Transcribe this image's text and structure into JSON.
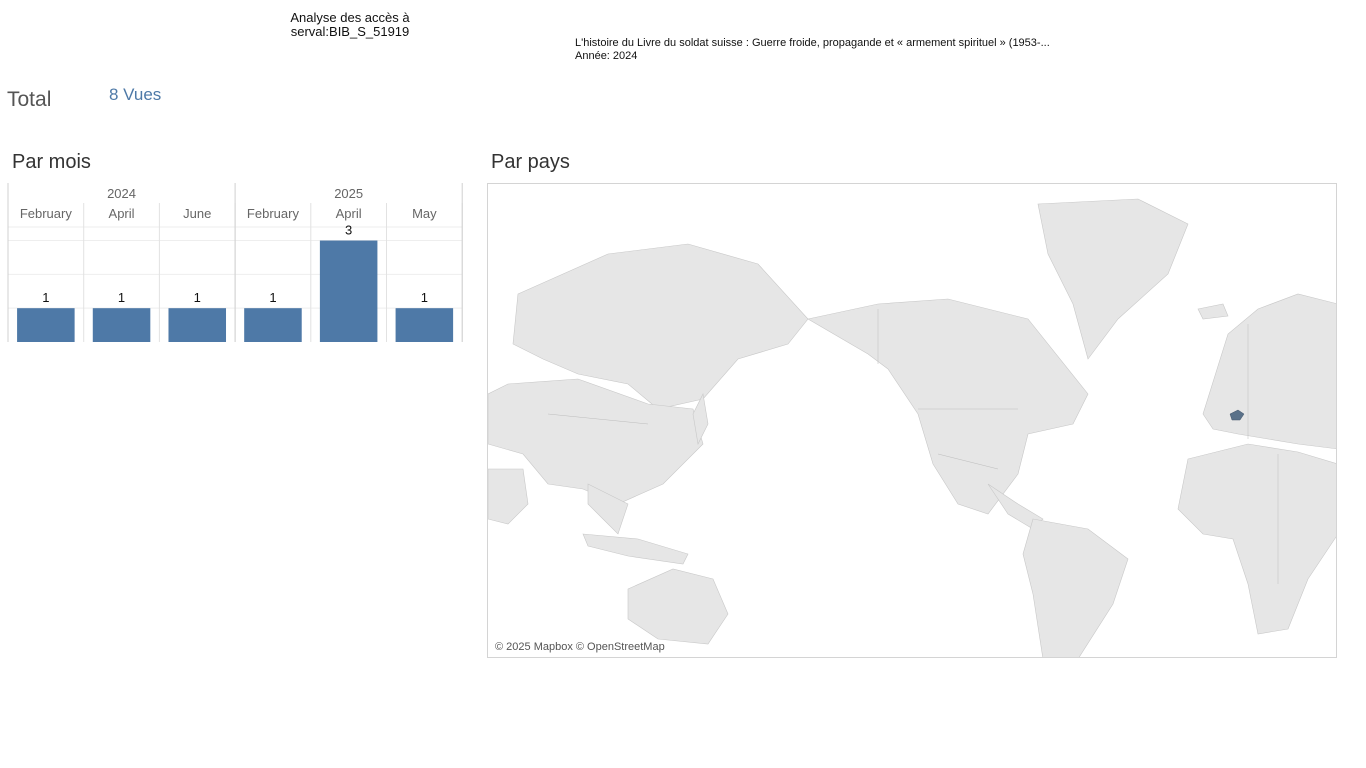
{
  "header": {
    "analysis_line1": "Analyse des accès à",
    "analysis_line2": "serval:BIB_S_51919",
    "doc_title": "L'histoire du Livre du soldat suisse : Guerre froide, propagande et « armement spirituel » (1953-...",
    "doc_year": "Année: 2024"
  },
  "total": {
    "label": "Total",
    "value": "8 Vues"
  },
  "par_mois": {
    "title": "Par mois"
  },
  "par_pays": {
    "title": "Par pays",
    "attribution": "© 2025 Mapbox © OpenStreetMap",
    "highlighted_country": "Switzerland"
  },
  "colors": {
    "bar": "#4e79a7",
    "accent_text": "#4e79a7",
    "map_land": "#e6e6e6",
    "map_highlight": "#5a7189"
  },
  "chart_data": {
    "type": "bar",
    "title": "Par mois",
    "years": [
      {
        "label": "2024",
        "span": 3
      },
      {
        "label": "2025",
        "span": 3
      }
    ],
    "categories": [
      "February",
      "April",
      "June",
      "February",
      "April",
      "May"
    ],
    "values": [
      1,
      1,
      1,
      1,
      3,
      1
    ],
    "ylim": [
      0,
      3.4
    ],
    "grid": true
  }
}
